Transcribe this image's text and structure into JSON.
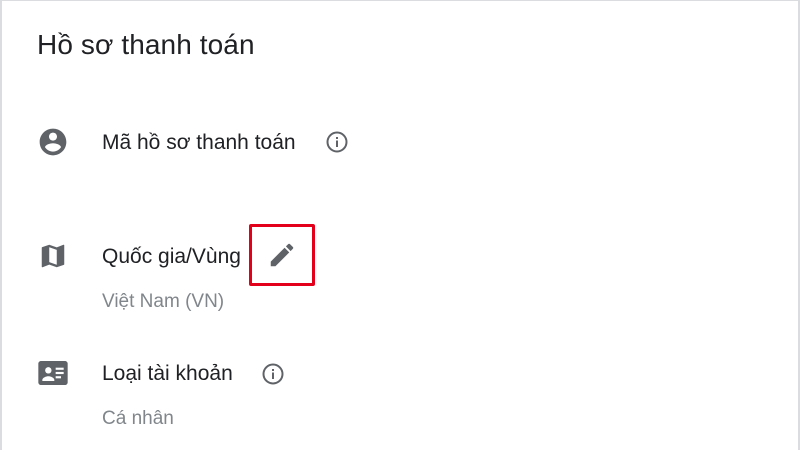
{
  "header": {
    "title": "Hồ sơ thanh toán"
  },
  "rows": {
    "profile_id": {
      "label": "Mã hồ sơ thanh toán",
      "icon": "account-circle-icon",
      "has_info": true
    },
    "country": {
      "label": "Quốc gia/Vùng",
      "value": "Việt Nam (VN)",
      "icon": "map-icon",
      "edit_icon": "pencil-icon",
      "highlight_color": "#e3001b"
    },
    "account_type": {
      "label": "Loại tài khoản",
      "value": "Cá nhân",
      "icon": "contact-card-icon",
      "has_info": true
    }
  },
  "colors": {
    "icon": "#5f6368",
    "text_primary": "#202124",
    "text_secondary": "#80868b",
    "highlight": "#e3001b"
  }
}
